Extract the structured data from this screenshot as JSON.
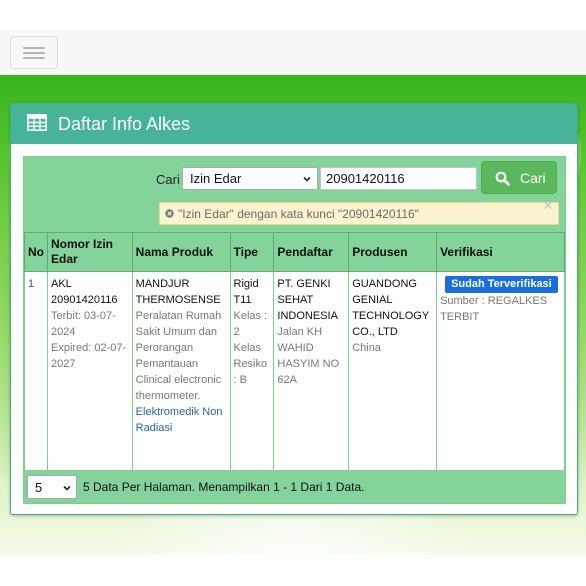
{
  "panel": {
    "title": "Daftar Info Alkes"
  },
  "search": {
    "label": "Cari",
    "field_selected": "Izin Edar",
    "query_value": "20901420116",
    "button_label": "Cari",
    "filter_tag": "\"Izin Edar\" dengan kata kunci \"20901420116\"",
    "dismiss": "×"
  },
  "table": {
    "headers": [
      "No",
      "Nomor Izin Edar",
      "Nama Produk",
      "Tipe",
      "Pendaftar",
      "Produsen",
      "Verifikasi"
    ],
    "rows": [
      {
        "no": "1",
        "izin_number": "AKL 20901420116",
        "terbit": "Terbit: 03-07-2024",
        "expired": "Expired: 02-07-2027",
        "product_name": "MANDJUR THERMOSENSE",
        "product_desc": "Peralatan Rumah Sakit Umum dan Perorangan Pemantauan Clinical electronic thermometer.",
        "product_category": "Elektromedik Non Radiasi",
        "tipe": "Rigid T11",
        "kelas": "Kelas : 2",
        "kelas_resiko": "Kelas Resiko : B",
        "pendaftar_name": "PT. GENKI SEHAT INDONESIA",
        "pendaftar_address": "Jalan KH WAHID HASYIM NO 62A",
        "produsen_name": "GUANDONG GENIAL TECHNOLOGY CO., LTD",
        "produsen_country": "China",
        "verification_badge": "Sudah Terverifikasi",
        "verification_source": "Sumber : REGALKES TERBIT"
      }
    ]
  },
  "pagination": {
    "per_page": "5",
    "summary": "5 Data Per Halaman. Menampilkan 1 - 1 Dari 1 Data."
  },
  "colors": {
    "header": "#48b497",
    "table_green": "#84d39a",
    "button_green": "#5cb85c",
    "badge_blue": "#1a6fe0"
  }
}
